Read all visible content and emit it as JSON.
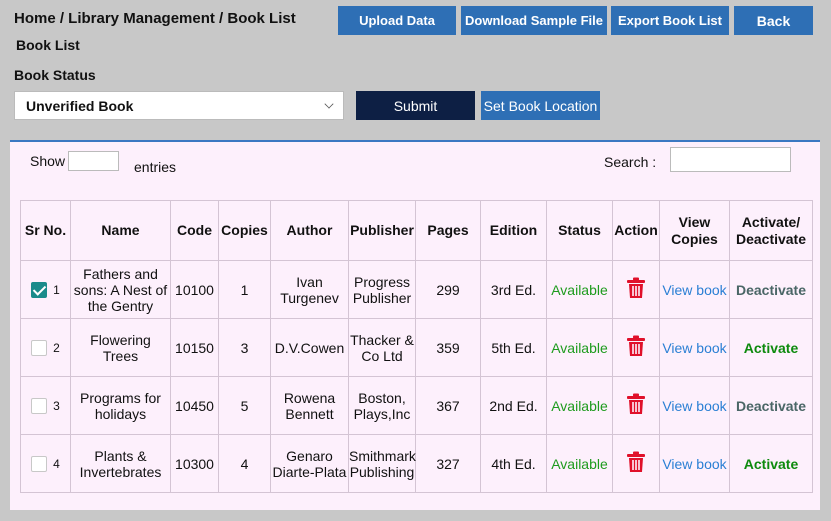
{
  "breadcrumb": "Home / Library Management / Book List",
  "buttons": {
    "upload": "Upload Data",
    "download_sample": "Download Sample File",
    "export": "Export Book List",
    "back": "Back",
    "submit": "Submit",
    "set_location": "Set Book Location"
  },
  "page_title": "Book List",
  "book_status": {
    "label": "Book Status",
    "selected": "Unverified Book"
  },
  "table_controls": {
    "show_label": "Show",
    "entries_label": "entries",
    "search_label": "Search :"
  },
  "columns": {
    "sr_no": "Sr No.",
    "name": "Name",
    "code": "Code",
    "copies": "Copies",
    "author": "Author",
    "publisher": "Publisher",
    "pages": "Pages",
    "edition": "Edition",
    "status": "Status",
    "action": "Action",
    "view_copies": "View Copies",
    "activate_deactivate": "Activate/ Deactivate"
  },
  "rows": [
    {
      "checked": true,
      "sr": "1",
      "name": "Fathers and sons: A Nest of the Gentry",
      "code": "10100",
      "copies": "1",
      "author": "Ivan Turgenev",
      "publisher": "Progress Publisher",
      "pages": "299",
      "edition": "3rd Ed.",
      "status": "Available",
      "view": "View book",
      "toggle": "Deactivate"
    },
    {
      "checked": false,
      "sr": "2",
      "name": "Flowering Trees",
      "code": "10150",
      "copies": "3",
      "author": "D.V.Cowen",
      "publisher": "Thacker & Co Ltd",
      "pages": "359",
      "edition": "5th Ed.",
      "status": "Available",
      "view": "View book",
      "toggle": "Activate"
    },
    {
      "checked": false,
      "sr": "3",
      "name": "Programs for holidays",
      "code": "10450",
      "copies": "5",
      "author": "Rowena Bennett",
      "publisher": "Boston, Plays,Inc",
      "pages": "367",
      "edition": "2nd Ed.",
      "status": "Available",
      "view": "View book",
      "toggle": "Deactivate"
    },
    {
      "checked": false,
      "sr": "4",
      "name": "Plants & Invertebrates",
      "code": "10300",
      "copies": "4",
      "author": "Genaro Diarte-Plata",
      "publisher": "Smithmark Publishing",
      "pages": "327",
      "edition": "4th Ed.",
      "status": "Available",
      "view": "View book",
      "toggle": "Activate"
    }
  ],
  "colors": {
    "primary_button": "#2e6fb5",
    "submit_button": "#0d1f44",
    "available": "#1e9b1e",
    "link": "#2a7fd4",
    "trash": "#e0102a",
    "activate": "#0d8a0d",
    "deactivate": "#4a6666"
  },
  "icons": {
    "delete": "trash-icon",
    "select_chevron": "chevron-down-icon",
    "row_checkbox": "checkbox-icon"
  }
}
